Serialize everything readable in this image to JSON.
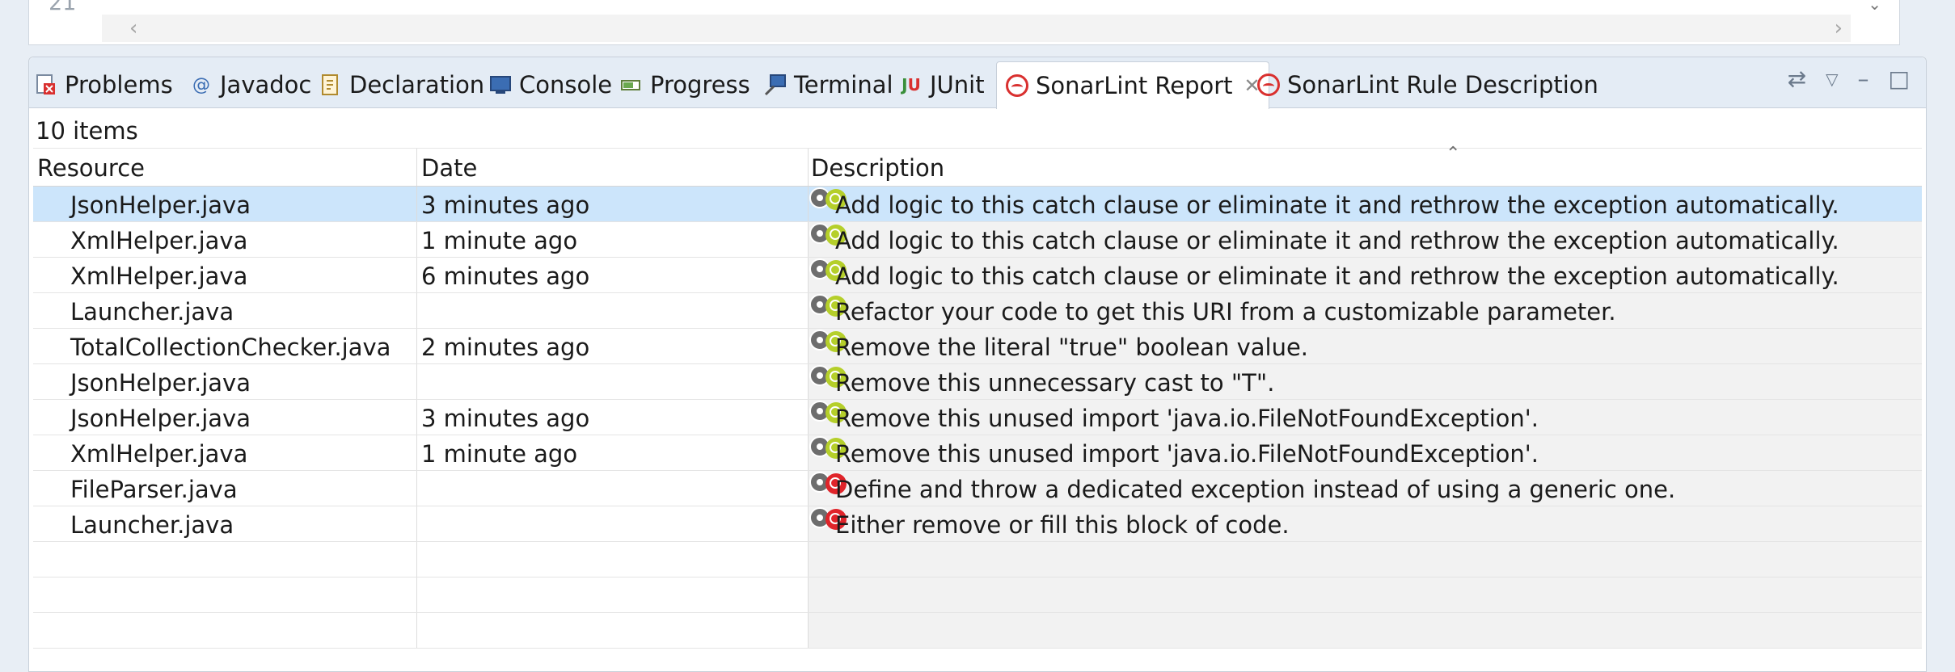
{
  "editor": {
    "line_number": "21"
  },
  "tabs": [
    {
      "label": "Problems",
      "icon": "problems-icon"
    },
    {
      "label": "Javadoc",
      "icon": "javadoc-icon"
    },
    {
      "label": "Declaration",
      "icon": "declaration-icon"
    },
    {
      "label": "Console",
      "icon": "console-icon"
    },
    {
      "label": "Progress",
      "icon": "progress-icon"
    },
    {
      "label": "Terminal",
      "icon": "terminal-icon"
    },
    {
      "label": "JUnit",
      "icon": "junit-icon"
    },
    {
      "label": "SonarLint Report",
      "icon": "sonarlint-icon",
      "active": true
    },
    {
      "label": "SonarLint Rule Description",
      "icon": "sonarlint-icon"
    }
  ],
  "report": {
    "items_count": "10 items",
    "columns": {
      "resource": "Resource",
      "date": "Date",
      "description": "Description"
    },
    "rows": [
      {
        "resource": "JsonHelper.java",
        "date": "3 minutes ago",
        "description": "Add logic to this catch clause or eliminate it and rethrow the exception automatically.",
        "severity": "minor"
      },
      {
        "resource": "XmlHelper.java",
        "date": "1 minute ago",
        "description": "Add logic to this catch clause or eliminate it and rethrow the exception automatically.",
        "severity": "minor"
      },
      {
        "resource": "XmlHelper.java",
        "date": "6 minutes ago",
        "description": "Add logic to this catch clause or eliminate it and rethrow the exception automatically.",
        "severity": "minor"
      },
      {
        "resource": "Launcher.java",
        "date": "",
        "description": "Refactor your code to get this URI from a customizable parameter.",
        "severity": "minor"
      },
      {
        "resource": "TotalCollectionChecker.java",
        "date": "2 minutes ago",
        "description": "Remove the literal \"true\" boolean value.",
        "severity": "minor"
      },
      {
        "resource": "JsonHelper.java",
        "date": "",
        "description": "Remove this unnecessary cast to \"T\".",
        "severity": "minor"
      },
      {
        "resource": "JsonHelper.java",
        "date": "3 minutes ago",
        "description": "Remove this unused import 'java.io.FileNotFoundException'.",
        "severity": "minor"
      },
      {
        "resource": "XmlHelper.java",
        "date": "1 minute ago",
        "description": "Remove this unused import 'java.io.FileNotFoundException'.",
        "severity": "minor"
      },
      {
        "resource": "FileParser.java",
        "date": "",
        "description": "Define and throw a dedicated exception instead of using a generic one.",
        "severity": "critical"
      },
      {
        "resource": "Launcher.java",
        "date": "",
        "description": "Either remove or fill this block of code.",
        "severity": "critical"
      }
    ]
  },
  "colors": {
    "selected_row": "#cce5fb",
    "minor": "#b5cf2a",
    "critical": "#e0242a",
    "sonarlint": "#d9302f"
  }
}
